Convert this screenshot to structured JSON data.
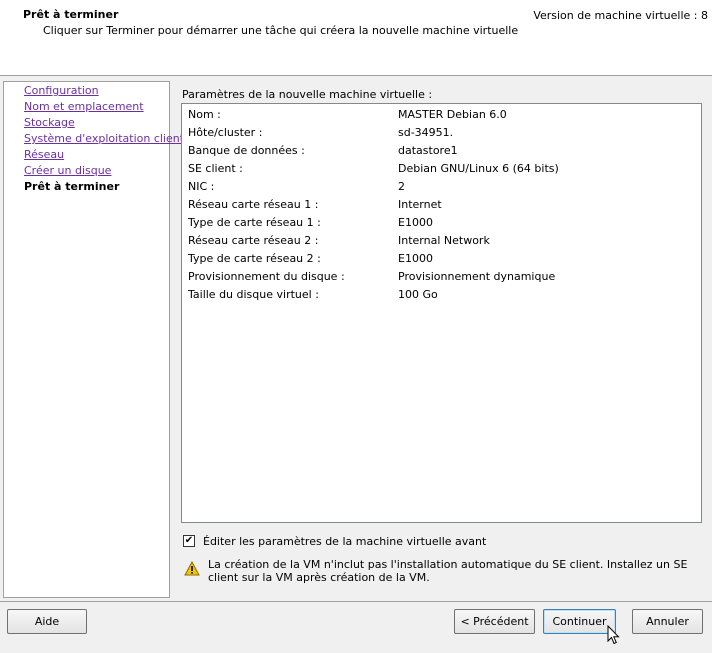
{
  "header": {
    "title": "Prêt à terminer",
    "subtitle": "Cliquer sur Terminer pour démarrer une tâche qui créera la nouvelle machine virtuelle",
    "version": "Version de machine virtuelle : 8"
  },
  "nav": {
    "items": [
      {
        "label": "Configuration"
      },
      {
        "label": "Nom et emplacement"
      },
      {
        "label": "Stockage"
      },
      {
        "label": "Système d'exploitation client"
      },
      {
        "label": "Réseau"
      },
      {
        "label": "Créer un disque"
      },
      {
        "label": "Prêt à terminer"
      }
    ]
  },
  "params": {
    "label": "Paramètres de la nouvelle machine virtuelle :",
    "rows": [
      {
        "k": "Nom :",
        "v": "MASTER Debian 6.0"
      },
      {
        "k": "Hôte/cluster :",
        "v": "sd-34951."
      },
      {
        "k": "Banque de données :",
        "v": "datastore1"
      },
      {
        "k": "SE client :",
        "v": "Debian GNU/Linux 6 (64 bits)"
      },
      {
        "k": "NIC :",
        "v": "2"
      },
      {
        "k": "Réseau carte réseau 1 :",
        "v": "Internet"
      },
      {
        "k": "Type de carte réseau 1 :",
        "v": "E1000"
      },
      {
        "k": "Réseau carte réseau 2 :",
        "v": "Internal Network"
      },
      {
        "k": "Type de carte réseau 2 :",
        "v": "E1000"
      },
      {
        "k": "Provisionnement du disque :",
        "v": "Provisionnement dynamique"
      },
      {
        "k": "Taille du disque virtuel :",
        "v": "100 Go"
      }
    ]
  },
  "edit_checkbox": {
    "checked": true,
    "mark": "✔",
    "label": "Éditer les paramètres de la machine virtuelle avant"
  },
  "warning": {
    "icon": "warning-icon",
    "text": "La création de la VM n'inclut pas l'installation automatique du SE client. Installez un SE client sur la VM après création de la VM."
  },
  "buttons": {
    "help": "Aide",
    "back": "< Précédent",
    "continue": "Continuer",
    "cancel": "Annuler"
  },
  "colors": {
    "link": "#6c2fa3",
    "focus_border": "#3c7fb1",
    "warning_yellow": "#f5c400"
  }
}
